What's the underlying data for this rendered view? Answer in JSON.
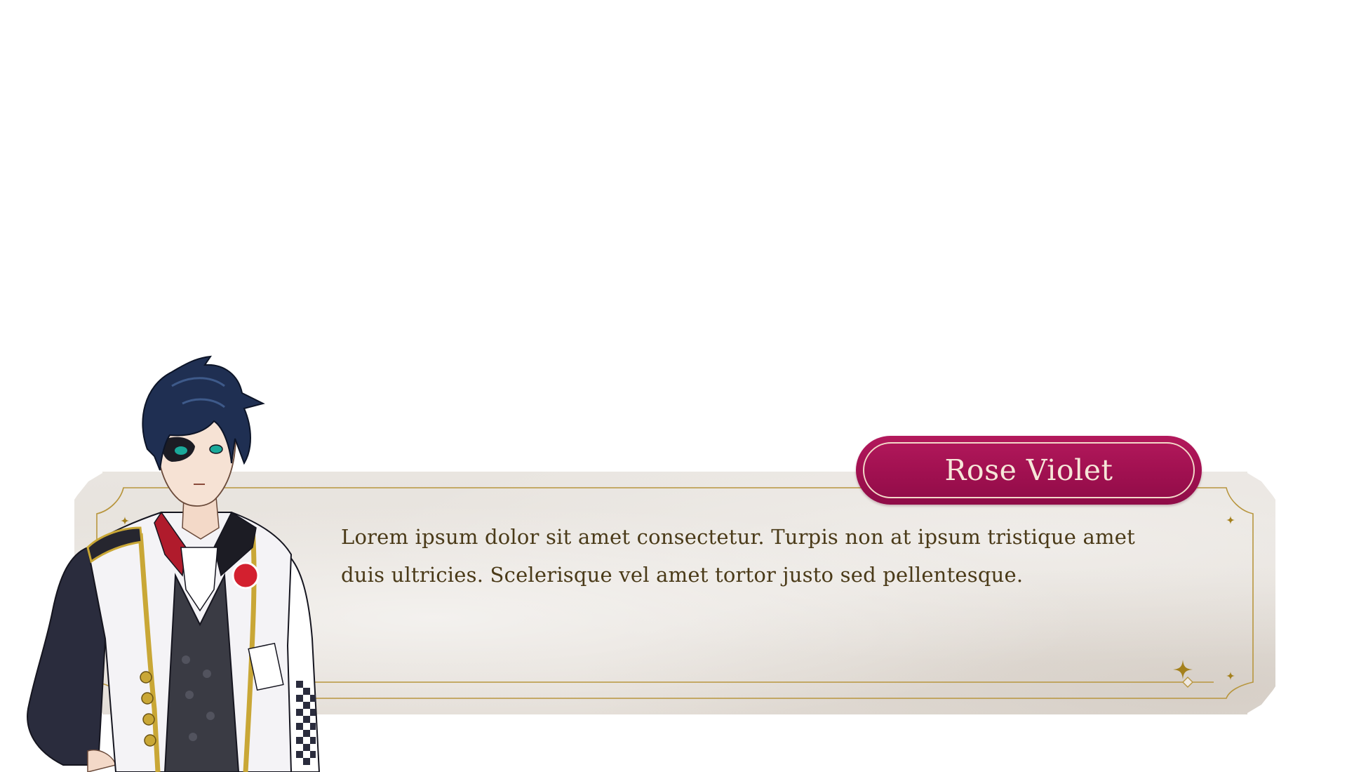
{
  "dialogue": {
    "speaker_name": "Rose Violet",
    "text": "Lorem ipsum dolor sit amet consectetur. Turpis non at ipsum tristique amet duis ultricies. Scelerisque vel amet tortor justo sed pellentesque."
  },
  "colors": {
    "name_plate": "#a01050",
    "name_text": "#f6e6d8",
    "dialogue_text": "#4a3a18",
    "frame_gold": "#b8963e",
    "paper": "#e7e2dc"
  },
  "icons": {
    "frame_ornaments": "sparkle-icon",
    "character": "character-portrait"
  }
}
